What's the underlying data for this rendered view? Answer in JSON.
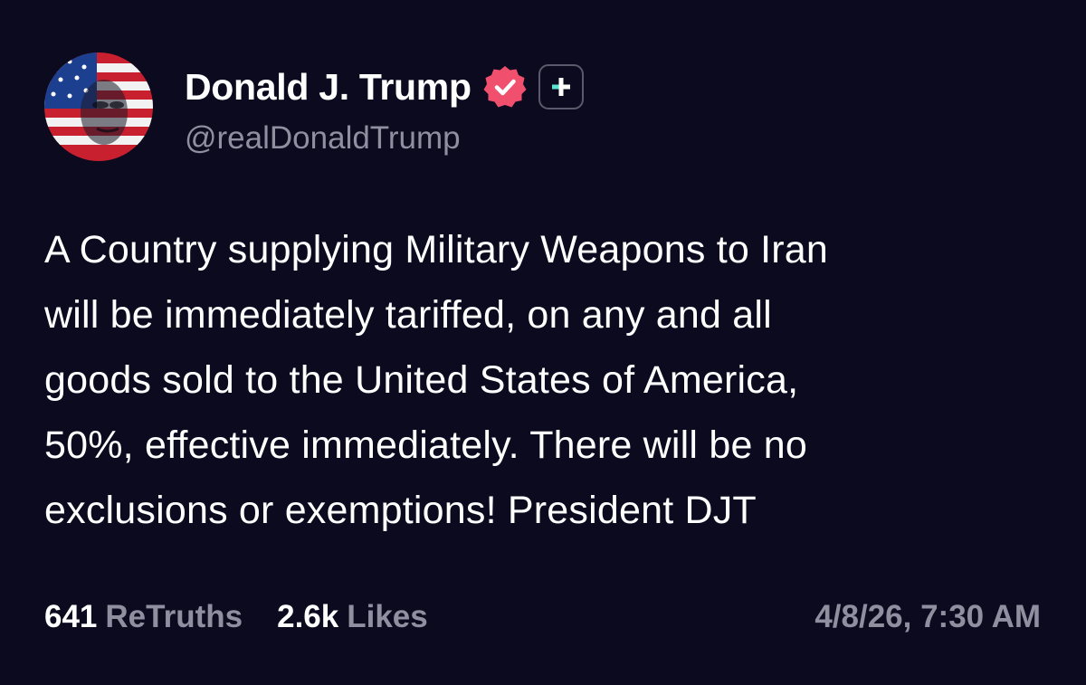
{
  "author": {
    "display_name": "Donald J. Trump",
    "handle": "@realDonaldTrump",
    "avatar_icon": "profile-avatar-flag-portrait",
    "verified_icon": "verified-badge-icon",
    "plus_icon": "plus-badge-icon"
  },
  "post": {
    "lines": [
      "A Country supplying Military Weapons to Iran",
      "will be immediately tariffed, on any and all",
      "goods sold to the United States of America,",
      "50%, effective immediately. There will be no",
      "exclusions or exemptions! President DJT"
    ]
  },
  "stats": {
    "retruths_count": "641",
    "retruths_label": "ReTruths",
    "likes_count": "2.6k",
    "likes_label": "Likes"
  },
  "timestamp": "4/8/26, 7:30 AM",
  "colors": {
    "background": "#0b0a1f",
    "primary_text": "#ffffff",
    "secondary_text": "#8f8fa0",
    "verified_badge": "#f0506e",
    "plus_accent": "#5ee2d0"
  }
}
